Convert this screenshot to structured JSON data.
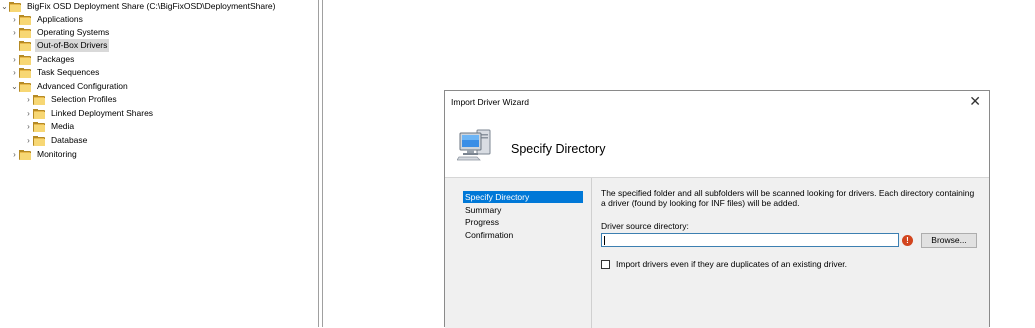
{
  "tree": {
    "items": [
      {
        "label": "BigFix OSD Deployment Share (C:\\BigFixOSD\\DeploymentShare)",
        "chevron": "⌄",
        "icon": "deployment-share-icon"
      },
      {
        "label": "Applications",
        "chevron": "›",
        "icon": "folder-icon"
      },
      {
        "label": "Operating Systems",
        "chevron": "›",
        "icon": "folder-icon"
      },
      {
        "label": "Out-of-Box Drivers",
        "chevron": "",
        "icon": "folder-icon",
        "selected": true
      },
      {
        "label": "Packages",
        "chevron": "›",
        "icon": "folder-icon"
      },
      {
        "label": "Task Sequences",
        "chevron": "›",
        "icon": "folder-icon"
      },
      {
        "label": "Advanced Configuration",
        "chevron": "⌄",
        "icon": "folder-icon"
      },
      {
        "label": "Selection Profiles",
        "chevron": "›",
        "icon": "folder-icon"
      },
      {
        "label": "Linked Deployment Shares",
        "chevron": "›",
        "icon": "folder-icon"
      },
      {
        "label": "Media",
        "chevron": "›",
        "icon": "folder-icon"
      },
      {
        "label": "Database",
        "chevron": "›",
        "icon": "database-folder-icon"
      },
      {
        "label": "Monitoring",
        "chevron": "›",
        "icon": "monitoring-folder-icon"
      }
    ]
  },
  "wizard": {
    "title": "Import Driver Wizard",
    "close_glyph": "✕",
    "header_title": "Specify Directory",
    "nav": [
      "Specify Directory",
      "Summary",
      "Progress",
      "Confirmation"
    ],
    "description": "The specified folder and all subfolders will be scanned looking for drivers.  Each directory containing a driver (found by looking for INF files) will be added.",
    "source_label": "Driver source directory:",
    "source_value": "",
    "error_glyph": "!",
    "browse_label": "Browse...",
    "checkbox_label": "Import drivers even if they are duplicates of an existing driver.",
    "checkbox_checked": false
  }
}
